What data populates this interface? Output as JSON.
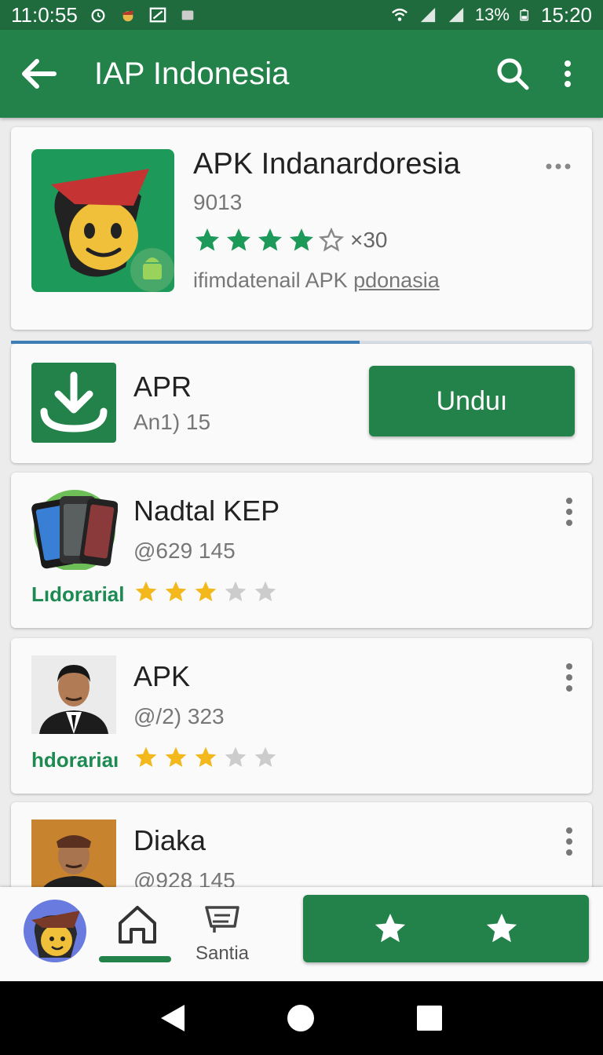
{
  "status_bar": {
    "time_left": "11:0:55",
    "battery": "13%",
    "time_right": "15:20"
  },
  "app_bar": {
    "title": "IAP Indonesia"
  },
  "hero": {
    "name": "APK Indanardoresia",
    "code": "9013",
    "rating_text": "×30",
    "subtitle_a": "ifimdatenail APK ",
    "subtitle_b": "pdonasia",
    "filled_stars": 4,
    "accent": "#23814a"
  },
  "download": {
    "title": "APR",
    "subtitle": "An1) 15",
    "button_label": "Unduı",
    "progress": 0.6
  },
  "items": [
    {
      "name": "Nadtal  KEP",
      "meta": "@629 145",
      "tag": "Lıdorarial",
      "stars": 3
    },
    {
      "name": "APK",
      "meta": "@/2) 323",
      "tag": "hdorariaı",
      "stars": 3
    },
    {
      "name": "Diaka",
      "meta": "@928 145"
    }
  ],
  "bottom_bar": {
    "santia_label": "Santia"
  },
  "colors": {
    "green_dark": "#1f6b3e",
    "green": "#23814a",
    "star_gold": "#f2b81c",
    "star_green": "#1d9a5a"
  }
}
